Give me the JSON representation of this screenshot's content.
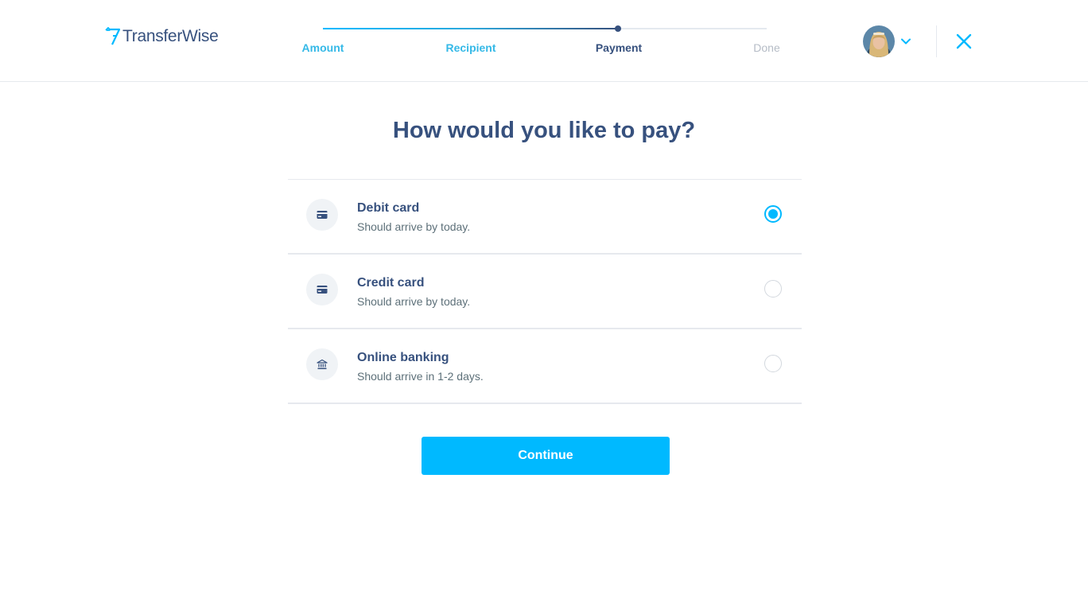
{
  "app": {
    "logo_text": "TransferWise"
  },
  "stepper": {
    "steps": [
      {
        "label": "Amount",
        "state": "done"
      },
      {
        "label": "Recipient",
        "state": "done"
      },
      {
        "label": "Payment",
        "state": "active"
      },
      {
        "label": "Done",
        "state": "todo"
      }
    ]
  },
  "main": {
    "title": "How would you like to pay?",
    "options": [
      {
        "title": "Debit card",
        "subtitle": "Should arrive by today.",
        "icon": "card-icon",
        "selected": true
      },
      {
        "title": "Credit card",
        "subtitle": "Should arrive by today.",
        "icon": "card-icon",
        "selected": false
      },
      {
        "title": "Online banking",
        "subtitle": "Should arrive in 1-2 days.",
        "icon": "bank-icon",
        "selected": false
      }
    ],
    "continue_label": "Continue"
  },
  "colors": {
    "primary": "#00b9ff",
    "navy": "#37517e",
    "muted": "#5d7079",
    "divider": "#e6e9ee"
  }
}
